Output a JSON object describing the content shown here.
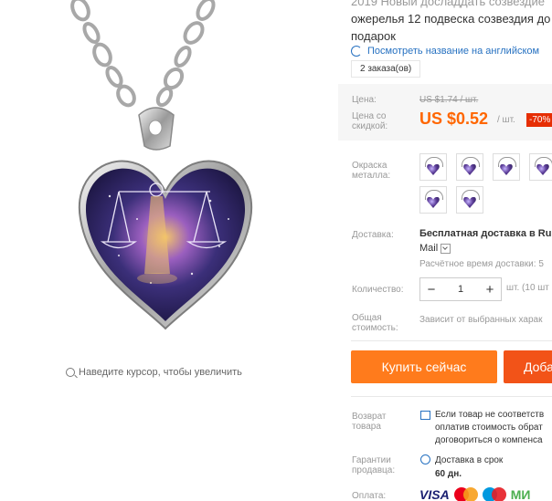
{
  "product": {
    "title_line1": "2019 Новый досладдать созвездие",
    "title_line2": "ожерелья 12 подвеска созвездия до",
    "title_line3": "подарок",
    "english_link": "Посмотреть название на английском",
    "orders": "2 заказа(ов)"
  },
  "gallery": {
    "zoom_hint": "Наведите курсор, чтобы увеличить"
  },
  "price": {
    "label": "Цена:",
    "old": "US $1.74 / шт.",
    "discount_label": "Цена со скидкой:",
    "new": "US $0.52",
    "per_unit": "/ шт.",
    "discount_badge": "-70%"
  },
  "color": {
    "label": "Окраска металла:",
    "options": [
      "variant-1",
      "variant-2",
      "variant-3",
      "variant-4",
      "variant-5",
      "variant-6"
    ]
  },
  "shipping": {
    "label": "Доставка:",
    "value": "Бесплатная доставка в Rus",
    "carrier": "Mail",
    "time": "Расчётное время доставки: 5"
  },
  "quantity": {
    "label": "Количество:",
    "minus": "−",
    "value": "1",
    "plus": "+",
    "unit": "шт. (10 шт"
  },
  "total": {
    "label": "Общая стоимость:",
    "value": "Зависит от выбранных харак"
  },
  "actions": {
    "buy_now": "Купить сейчас",
    "add_to_cart": "Доба"
  },
  "returns": {
    "label": "Возврат товара",
    "line1": "Если товар не соответств",
    "line2": "оплатив стоимость обрат",
    "line3": "договориться о компенса"
  },
  "guarantee": {
    "label": "Гарантии продавца:",
    "line1": "Доставка в срок",
    "line2": "60 дн."
  },
  "payment": {
    "label": "Оплата:",
    "visa": "VISA",
    "mir": "МИ"
  },
  "colors": {
    "price_orange": "#ff6600",
    "buy_button": "#ff7b1c",
    "cart_button": "#f25318",
    "discount_red": "#e62e04",
    "link_blue": "#2671c1"
  }
}
